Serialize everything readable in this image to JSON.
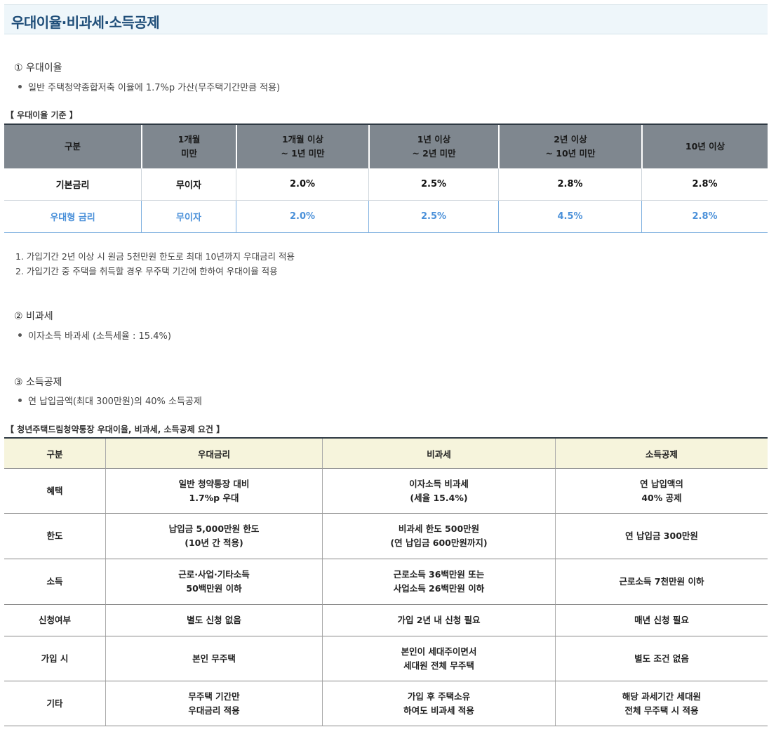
{
  "page_title": "우대이율·비과세·소득공제",
  "sections": {
    "s1_heading": "① 우대이율",
    "s1_bullet": "일반 주택청약종합저축 이율에 1.7%p 가산(무주택기간만큼 적용)",
    "s2_heading": "② 비과세",
    "s2_bullet": "이자소득 바과세 (소득세율 : 15.4%)",
    "s3_heading": "③ 소득공제",
    "s3_bullet": "연 납입금액(최대 300만원)의 40% 소득공제"
  },
  "rate_table": {
    "caption": "【 우대이율 기준 】",
    "headers": [
      "구분",
      "1개월\n미만",
      "1개월 이상\n~ 1년 미만",
      "1년 이상\n~ 2년 미만",
      "2년 이상\n~ 10년 미만",
      "10년 이상"
    ],
    "rows": [
      [
        "기본금리",
        "무이자",
        "2.0%",
        "2.5%",
        "2.8%",
        "2.8%"
      ],
      [
        "우대형 금리",
        "무이자",
        "2.0%",
        "2.5%",
        "4.5%",
        "2.8%"
      ]
    ],
    "highlight_color": "#4a90d9"
  },
  "notes": [
    "1. 가입기간 2년 이상 시 원금 5천만원 한도로 최대 10년까지 우대금리 적용",
    "2. 가입기간 중 주택을 취득할 경우 무주택 기간에 한하여 우대이율 적용"
  ],
  "req_table": {
    "caption": "【 청년주택드림청약통장 우대이율, 비과세, 소득공제 요건 】",
    "headers": [
      "구분",
      "우대금리",
      "비과세",
      "소득공제"
    ],
    "rows": [
      [
        "혜택",
        "일반 청약통장 대비\n1.7%p 우대",
        "이자소득 비과세\n(세율 15.4%)",
        "연 납입액의\n40% 공제"
      ],
      [
        "한도",
        "납입금 5,000만원 한도\n(10년 간 적용)",
        "비과세 한도 500만원\n(연 납입금 600만원까지)",
        "연 납입금 300만원"
      ],
      [
        "소득",
        "근로·사업·기타소득\n50백만원 이하",
        "근로소득 36백만원 또는\n사업소득 26백만원 이하",
        "근로소득 7천만원 이하"
      ],
      [
        "신청여부",
        "별도 신청 없음",
        "가입 2년 내 신청 필요",
        "매년 신청 필요"
      ],
      [
        "가입 시",
        "본인 무주택",
        "본인이 세대주이면서\n세대원 전체 무주택",
        "별도 조건 없음"
      ],
      [
        "기타",
        "무주택 기간만\n우대금리 적용",
        "가입 후 주택소유\n하여도 비과세 적용",
        "해당 과세기간 세대원\n전체 무주택 시 적용"
      ]
    ]
  }
}
